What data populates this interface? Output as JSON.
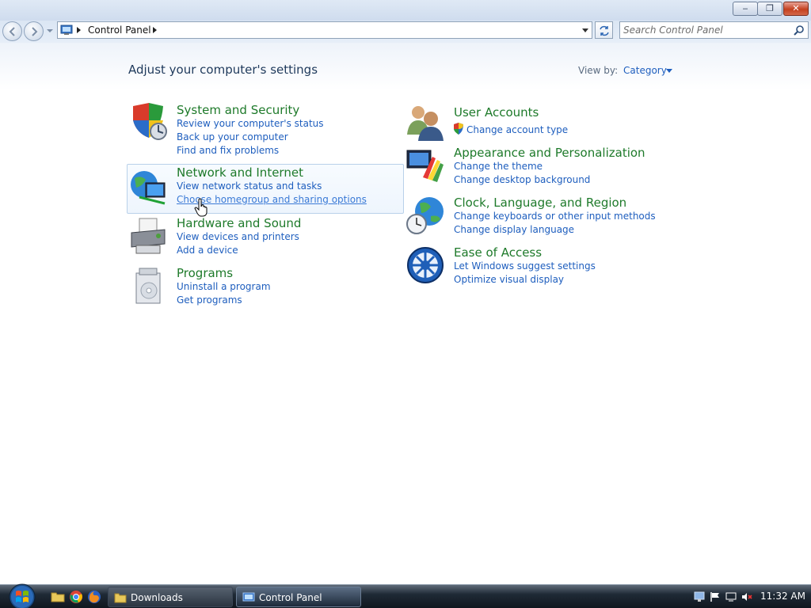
{
  "window": {
    "minimize_glyph": "‒",
    "maximize_glyph": "❐",
    "close_glyph": "✕"
  },
  "nav": {
    "breadcrumb": "Control Panel",
    "search_placeholder": "Search Control Panel"
  },
  "content": {
    "heading": "Adjust your computer's settings",
    "view_by_label": "View by:",
    "view_by_value": "Category"
  },
  "categories": {
    "system_security": {
      "title": "System and Security",
      "links": [
        "Review your computer's status",
        "Back up your computer",
        "Find and fix problems"
      ]
    },
    "network_internet": {
      "title": "Network and Internet",
      "links": [
        "View network status and tasks",
        "Choose homegroup and sharing options"
      ]
    },
    "hardware_sound": {
      "title": "Hardware and Sound",
      "links": [
        "View devices and printers",
        "Add a device"
      ]
    },
    "programs": {
      "title": "Programs",
      "links": [
        "Uninstall a program",
        "Get programs"
      ]
    },
    "user_accounts": {
      "title": "User Accounts",
      "links": [
        "Change account type"
      ]
    },
    "appearance": {
      "title": "Appearance and Personalization",
      "links": [
        "Change the theme",
        "Change desktop background"
      ]
    },
    "clock_region": {
      "title": "Clock, Language, and Region",
      "links": [
        "Change keyboards or other input methods",
        "Change display language"
      ]
    },
    "ease_access": {
      "title": "Ease of Access",
      "links": [
        "Let Windows suggest settings",
        "Optimize visual display"
      ]
    }
  },
  "taskbar": {
    "buttons": [
      {
        "label": "Downloads"
      },
      {
        "label": "Control Panel"
      }
    ],
    "clock": "11:32 AM"
  },
  "colors": {
    "link": "#1e5ebe",
    "category_title": "#1e7a2a",
    "heading": "#1e395b"
  }
}
